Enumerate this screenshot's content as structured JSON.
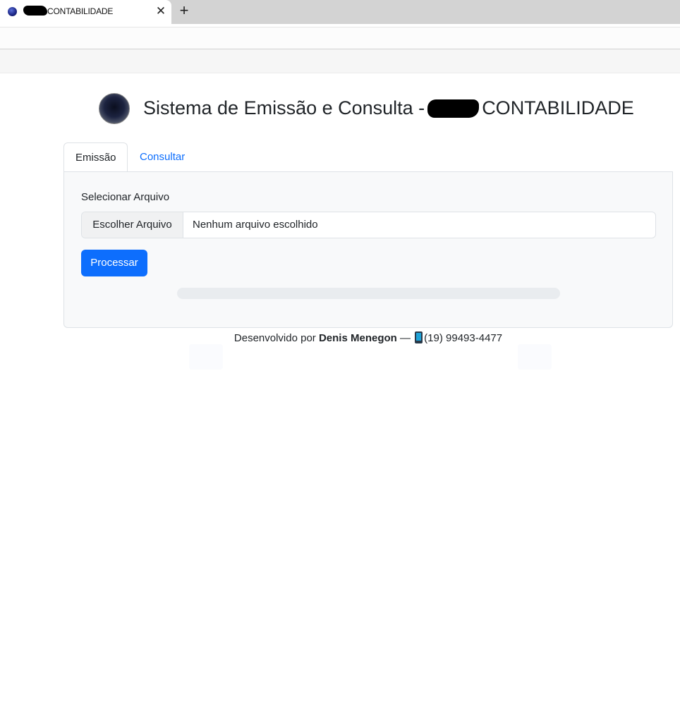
{
  "browser": {
    "tab_title": "CONTABILIDADE",
    "close_glyph": "✕",
    "new_tab_glyph": "+"
  },
  "header": {
    "title_prefix": "Sistema de Emissão e Consulta -",
    "title_suffix": "CONTABILIDADE"
  },
  "tabs": [
    {
      "label": "Emissão",
      "active": true
    },
    {
      "label": "Consultar",
      "active": false
    }
  ],
  "form": {
    "field_label": "Selecionar Arquivo",
    "file_button_label": "Escolher Arquivo",
    "file_status": "Nenhum arquivo escolhido",
    "submit_label": "Processar",
    "progress": 0
  },
  "footer": {
    "prefix": "Desenvolvido por",
    "author": "Denis Menegon",
    "separator": "—",
    "phone_icon": "mobile-phone-icon",
    "phone": "(19) 99493-4477"
  },
  "colors": {
    "accent": "#0d6efd",
    "panel_bg": "#f8f9fa",
    "border": "#dee2e6"
  }
}
